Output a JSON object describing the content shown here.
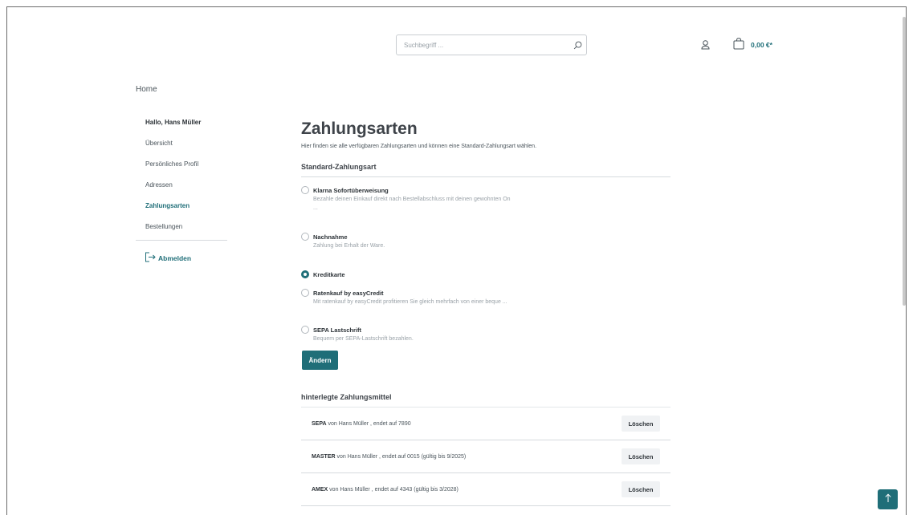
{
  "header": {
    "search_placeholder": "Suchbegriff ...",
    "cart_total": "0,00 €*"
  },
  "breadcrumb": {
    "home": "Home"
  },
  "sidebar": {
    "greeting": "Hallo, Hans Müller",
    "items": [
      {
        "label": "Übersicht",
        "active": false
      },
      {
        "label": "Persönliches Profil",
        "active": false
      },
      {
        "label": "Adressen",
        "active": false
      },
      {
        "label": "Zahlungsarten",
        "active": true
      },
      {
        "label": "Bestellungen",
        "active": false
      }
    ],
    "logout": "Abmelden"
  },
  "main": {
    "title": "Zahlungsarten",
    "subtitle": "Hier finden sie alle verfügbaren Zahlungsarten und können eine Standard-Zahlungsart wählen.",
    "section_title": "Standard-Zahlungsart",
    "methods": [
      {
        "name": "Klarna Sofortüberweisung",
        "description": "Bezahle deinen Einkauf direkt nach Bestellabschluss mit deinen gewohnten On",
        "ellipsis": "...",
        "selected": false
      },
      {
        "name": "Nachnahme",
        "description": "Zahlung bei Erhalt der Ware.",
        "selected": false
      },
      {
        "name": "Kreditkarte",
        "description": "",
        "selected": true
      },
      {
        "name": "Ratenkauf by easyCredit",
        "description": "Mit ratenkauf by easyCredit profitieren Sie gleich mehrfach von einer beque ...",
        "selected": false
      },
      {
        "name": "SEPA Lastschrift",
        "description": "Bequem per SEPA-Lastschrift bezahlen.",
        "selected": false
      }
    ],
    "change_button": "Ändern",
    "saved_title": "hinterlegte Zahlungsmittel",
    "saved": [
      {
        "brand": "SEPA",
        "text": " von Hans Müller , endet auf 7890",
        "delete_label": "Löschen"
      },
      {
        "brand": "MASTER",
        "text": " von Hans Müller , endet auf 0015 (gültig bis 9/2025)",
        "delete_label": "Löschen"
      },
      {
        "brand": "AMEX",
        "text": " von Hans Müller , endet auf 4343 (gültig bis 3/2028)",
        "delete_label": "Löschen"
      }
    ]
  },
  "colors": {
    "accent": "#1f6e78",
    "text": "#4a545b",
    "muted": "#9aa2a8"
  },
  "icons": [
    "search-icon",
    "account-icon",
    "cart-icon",
    "logout-icon",
    "arrow-up-icon"
  ]
}
